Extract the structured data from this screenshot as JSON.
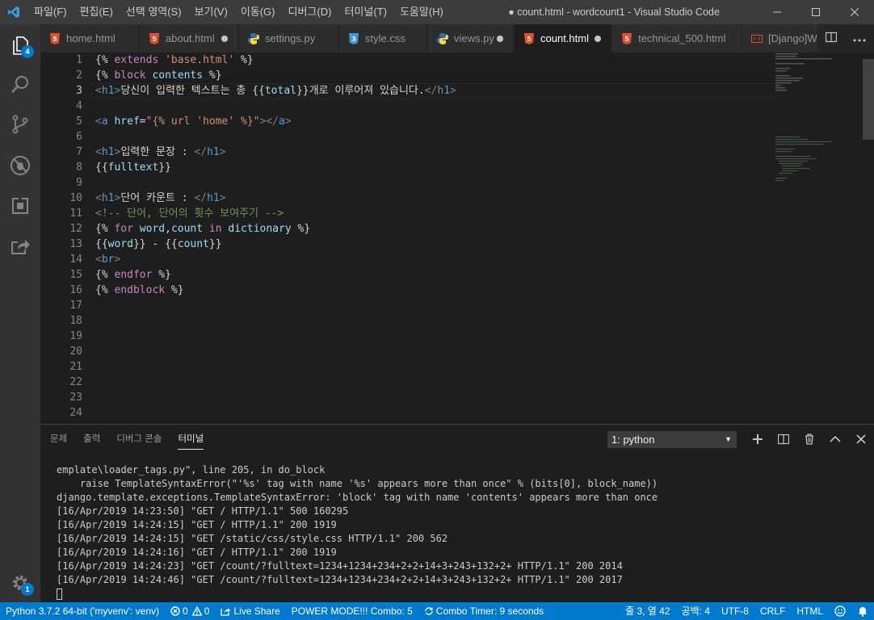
{
  "window": {
    "title": "● count.html - wordcount1 - Visual Studio Code"
  },
  "menu": [
    "파일(F)",
    "편집(E)",
    "선택 영역(S)",
    "보기(V)",
    "이동(G)",
    "디버그(D)",
    "터미널(T)",
    "도움말(H)"
  ],
  "activity": {
    "explorer_badge": "4",
    "settings_badge": "1"
  },
  "tabs": [
    {
      "label": "home.html",
      "icon": "html5-icon",
      "dirty": false,
      "active": false
    },
    {
      "label": "about.html",
      "icon": "html5-icon",
      "dirty": true,
      "active": false
    },
    {
      "label": "settings.py",
      "icon": "python-icon",
      "dirty": false,
      "active": false
    },
    {
      "label": "style.css",
      "icon": "css3-icon",
      "dirty": false,
      "active": false
    },
    {
      "label": "views.py",
      "icon": "python-icon",
      "dirty": true,
      "active": false
    },
    {
      "label": "count.html",
      "icon": "html5-icon",
      "dirty": true,
      "active": true
    },
    {
      "label": "technical_500.html",
      "icon": "html5-icon",
      "dirty": false,
      "active": false
    },
    {
      "label": "[Django]W",
      "icon": "preview-icon",
      "dirty": false,
      "active": false
    }
  ],
  "editor": {
    "line_numbers": [
      "1",
      "2",
      "3",
      "4",
      "5",
      "6",
      "7",
      "8",
      "9",
      "10",
      "11",
      "12",
      "13",
      "14",
      "15",
      "16",
      "17",
      "18",
      "19",
      "20",
      "21",
      "22",
      "23",
      "24"
    ],
    "current_line": 3,
    "lines": [
      [
        {
          "t": "{% ",
          "c": "delim"
        },
        {
          "t": "extends",
          "c": "kw"
        },
        {
          "t": " ",
          "c": "text"
        },
        {
          "t": "'base.html'",
          "c": "str"
        },
        {
          "t": " %}",
          "c": "delim"
        }
      ],
      [
        {
          "t": "{% ",
          "c": "delim"
        },
        {
          "t": "block",
          "c": "kw"
        },
        {
          "t": " ",
          "c": "text"
        },
        {
          "t": "contents",
          "c": "var"
        },
        {
          "t": " %}",
          "c": "delim"
        }
      ],
      [
        {
          "t": "<",
          "c": "angle"
        },
        {
          "t": "h1",
          "c": "tag"
        },
        {
          "t": ">",
          "c": "angle"
        },
        {
          "t": "당신이 입력한 텍스트는 총 ",
          "c": "text"
        },
        {
          "t": "{{",
          "c": "delim"
        },
        {
          "t": "total",
          "c": "var"
        },
        {
          "t": "}}",
          "c": "delim"
        },
        {
          "t": "개로 이루어져 있습니다.",
          "c": "text"
        },
        {
          "t": "</",
          "c": "angle"
        },
        {
          "t": "h1",
          "c": "tag"
        },
        {
          "t": ">",
          "c": "angle"
        }
      ],
      [],
      [
        {
          "t": "<",
          "c": "angle"
        },
        {
          "t": "a",
          "c": "tag"
        },
        {
          "t": " ",
          "c": "text"
        },
        {
          "t": "href",
          "c": "attr"
        },
        {
          "t": "=",
          "c": "text"
        },
        {
          "t": "\"{% url 'home' %}\"",
          "c": "str"
        },
        {
          "t": "></",
          "c": "angle"
        },
        {
          "t": "a",
          "c": "tag"
        },
        {
          "t": ">",
          "c": "angle"
        }
      ],
      [],
      [
        {
          "t": "<",
          "c": "angle"
        },
        {
          "t": "h1",
          "c": "tag"
        },
        {
          "t": ">",
          "c": "angle"
        },
        {
          "t": "입력한 문장 : ",
          "c": "text"
        },
        {
          "t": "</",
          "c": "angle"
        },
        {
          "t": "h1",
          "c": "tag"
        },
        {
          "t": ">",
          "c": "angle"
        }
      ],
      [
        {
          "t": "{{",
          "c": "delim"
        },
        {
          "t": "fulltext",
          "c": "var"
        },
        {
          "t": "}}",
          "c": "delim"
        }
      ],
      [],
      [
        {
          "t": "<",
          "c": "angle"
        },
        {
          "t": "h1",
          "c": "tag"
        },
        {
          "t": ">",
          "c": "angle"
        },
        {
          "t": "단어 카운트 : ",
          "c": "text"
        },
        {
          "t": "</",
          "c": "angle"
        },
        {
          "t": "h1",
          "c": "tag"
        },
        {
          "t": ">",
          "c": "angle"
        }
      ],
      [
        {
          "t": "<!-- 단어, 단어의 횟수 보여주기 -->",
          "c": "cmt"
        }
      ],
      [
        {
          "t": "{% ",
          "c": "delim"
        },
        {
          "t": "for",
          "c": "kw"
        },
        {
          "t": " ",
          "c": "text"
        },
        {
          "t": "word",
          "c": "var"
        },
        {
          "t": ",",
          "c": "text"
        },
        {
          "t": "count",
          "c": "var"
        },
        {
          "t": " ",
          "c": "text"
        },
        {
          "t": "in",
          "c": "kw"
        },
        {
          "t": " ",
          "c": "text"
        },
        {
          "t": "dictionary",
          "c": "var"
        },
        {
          "t": " %}",
          "c": "delim"
        }
      ],
      [
        {
          "t": "{{",
          "c": "delim"
        },
        {
          "t": "word",
          "c": "var"
        },
        {
          "t": "}}",
          "c": "delim"
        },
        {
          "t": " - ",
          "c": "text"
        },
        {
          "t": "{{",
          "c": "delim"
        },
        {
          "t": "count",
          "c": "var"
        },
        {
          "t": "}}",
          "c": "delim"
        }
      ],
      [
        {
          "t": "<",
          "c": "angle"
        },
        {
          "t": "br",
          "c": "tag"
        },
        {
          "t": ">",
          "c": "angle"
        }
      ],
      [
        {
          "t": "{% ",
          "c": "delim"
        },
        {
          "t": "endfor",
          "c": "kw"
        },
        {
          "t": " %}",
          "c": "delim"
        }
      ],
      [
        {
          "t": "{% ",
          "c": "delim"
        },
        {
          "t": "endblock",
          "c": "kw"
        },
        {
          "t": " %}",
          "c": "delim"
        }
      ]
    ]
  },
  "panel": {
    "tabs": [
      "문제",
      "출력",
      "디버그 콘솔",
      "터미널"
    ],
    "active_tab": "터미널",
    "terminal_select": "1: python",
    "terminal_lines": [
      "emplate\\loader_tags.py\", line 205, in do_block",
      "    raise TemplateSyntaxError(\"'%s' tag with name '%s' appears more than once\" % (bits[0], block_name))",
      "django.template.exceptions.TemplateSyntaxError: 'block' tag with name 'contents' appears more than once",
      "[16/Apr/2019 14:23:50] \"GET / HTTP/1.1\" 500 160295",
      "[16/Apr/2019 14:24:15] \"GET / HTTP/1.1\" 200 1919",
      "[16/Apr/2019 14:24:15] \"GET /static/css/style.css HTTP/1.1\" 200 562",
      "[16/Apr/2019 14:24:16] \"GET / HTTP/1.1\" 200 1919",
      "[16/Apr/2019 14:24:23] \"GET /count/?fulltext=1234+1234+234+2+2+14+3+243+132+2+ HTTP/1.1\" 200 2014",
      "[16/Apr/2019 14:24:46] \"GET /count/?fulltext=1234+1234+234+2+2+14+3+243+132+2+ HTTP/1.1\" 200 2017"
    ]
  },
  "status": {
    "python": "Python 3.7.2 64-bit ('myvenv': venv)",
    "errors": "0",
    "warnings": "0",
    "live_share": "Live Share",
    "power_mode": "POWER MODE!!! Combo: 5",
    "combo_timer": "Combo Timer: 9 seconds",
    "position": "줄 3, 열 42",
    "indent": "공백: 4",
    "encoding": "UTF-8",
    "eol": "CRLF",
    "language": "HTML"
  },
  "colors": {
    "accent": "#007acc",
    "html_icon": "#e44d26",
    "css_icon": "#3c99dc",
    "python_icon": "#3572a5"
  }
}
